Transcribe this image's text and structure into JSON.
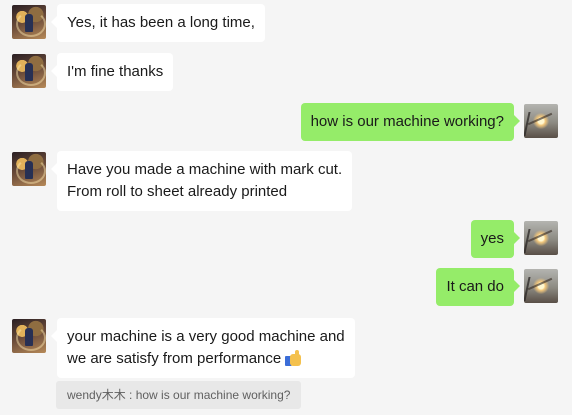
{
  "messages": [
    {
      "side": "left",
      "text": "Yes, it has been a long time,"
    },
    {
      "side": "left",
      "text": "I'm fine thanks"
    },
    {
      "side": "right",
      "text": "how is our machine working?"
    },
    {
      "side": "left",
      "lines": [
        "Have you made a machine with mark cut.",
        "From roll to sheet already printed"
      ]
    },
    {
      "side": "right",
      "text": "yes"
    },
    {
      "side": "right",
      "text": "It can do"
    },
    {
      "side": "left",
      "lines": [
        "your machine is a very good machine and",
        "we are satisfy from performance"
      ],
      "emoji": "thumbs-up"
    }
  ],
  "quote": {
    "text": "wendy木木 : how is our machine working?"
  },
  "colors": {
    "background": "#f5f5f5",
    "incoming": "#ffffff",
    "outgoing": "#95ec69",
    "quote_bg": "#e8e8e8"
  }
}
